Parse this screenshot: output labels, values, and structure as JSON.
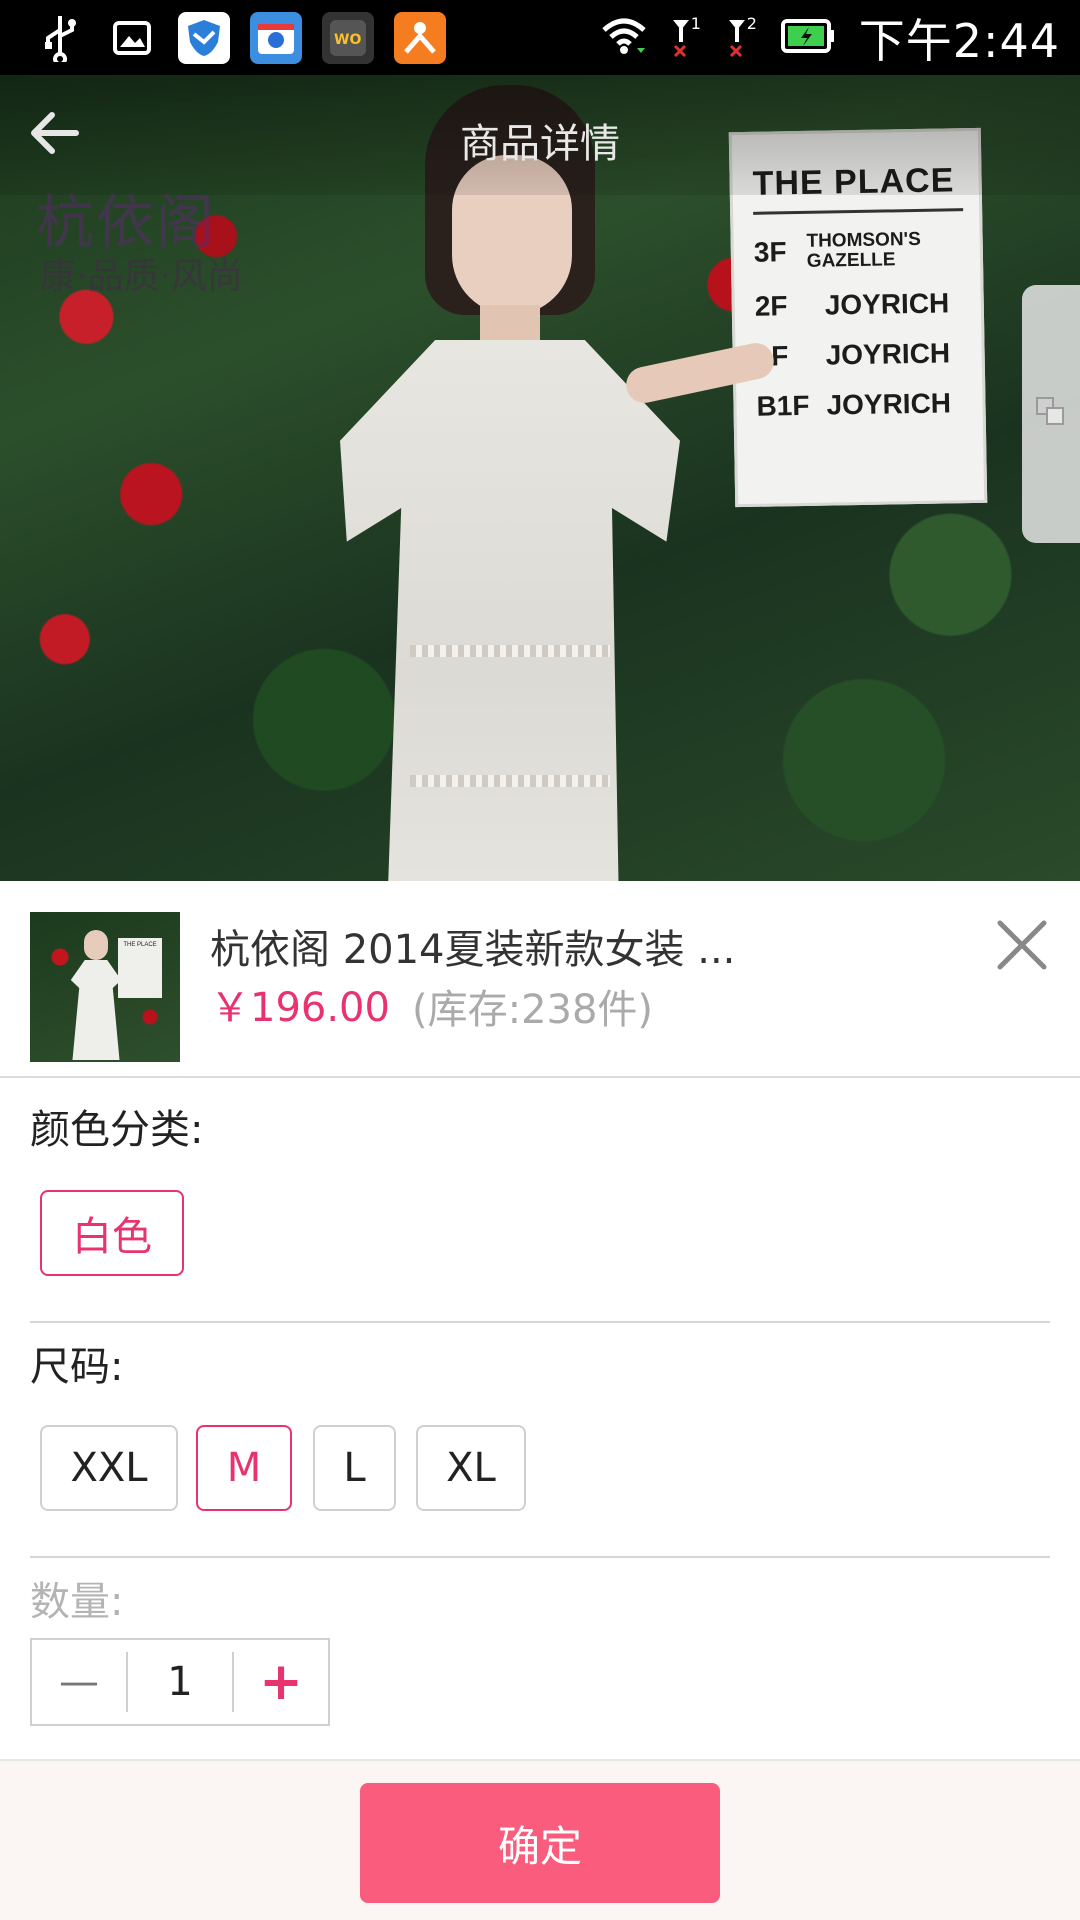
{
  "status_bar": {
    "time": "下午2:44",
    "icons": [
      "usb-icon",
      "gallery-icon",
      "security-shield-icon",
      "baidu-app-icon",
      "wostore-app-icon",
      "dianping-app-icon",
      "wifi-icon",
      "signal-1-icon",
      "signal-2-icon",
      "battery-charging-icon"
    ],
    "sim1_label": "1",
    "sim2_label": "2"
  },
  "header": {
    "title": "商品详情",
    "back_icon": "back-arrow-icon",
    "side_tab_icon": "copy-icon"
  },
  "hero": {
    "logo_text": "杭依阁",
    "logo_subtext": "康·品质·风尚",
    "sign": {
      "title": "THE PLACE",
      "rows": [
        {
          "floor": "3F",
          "name": "THOMSON'S GAZELLE"
        },
        {
          "floor": "2F",
          "name": "JOYRICH"
        },
        {
          "floor": "1F",
          "name": "JOYRICH"
        },
        {
          "floor": "B1F",
          "name": "JOYRICH"
        }
      ]
    }
  },
  "product": {
    "title": "杭依阁 2014夏装新款女装 ...",
    "price": "￥196.00",
    "stock": "(库存:238件)",
    "thumb_sign_text": "THE PLACE"
  },
  "color_section": {
    "label": "颜色分类:",
    "options": [
      {
        "label": "白色",
        "selected": true
      }
    ]
  },
  "size_section": {
    "label": "尺码:",
    "options": [
      {
        "label": "XXL",
        "selected": false
      },
      {
        "label": "M",
        "selected": true
      },
      {
        "label": "L",
        "selected": false
      },
      {
        "label": "XL",
        "selected": false
      }
    ]
  },
  "quantity_section": {
    "label": "数量:",
    "value": "1",
    "decrement": "—",
    "increment": "+"
  },
  "footer": {
    "confirm_label": "确定"
  },
  "colors": {
    "accent_pink": "#e8336e",
    "confirm_bg": "#f95c7d",
    "muted_text": "#aaaaaa"
  }
}
